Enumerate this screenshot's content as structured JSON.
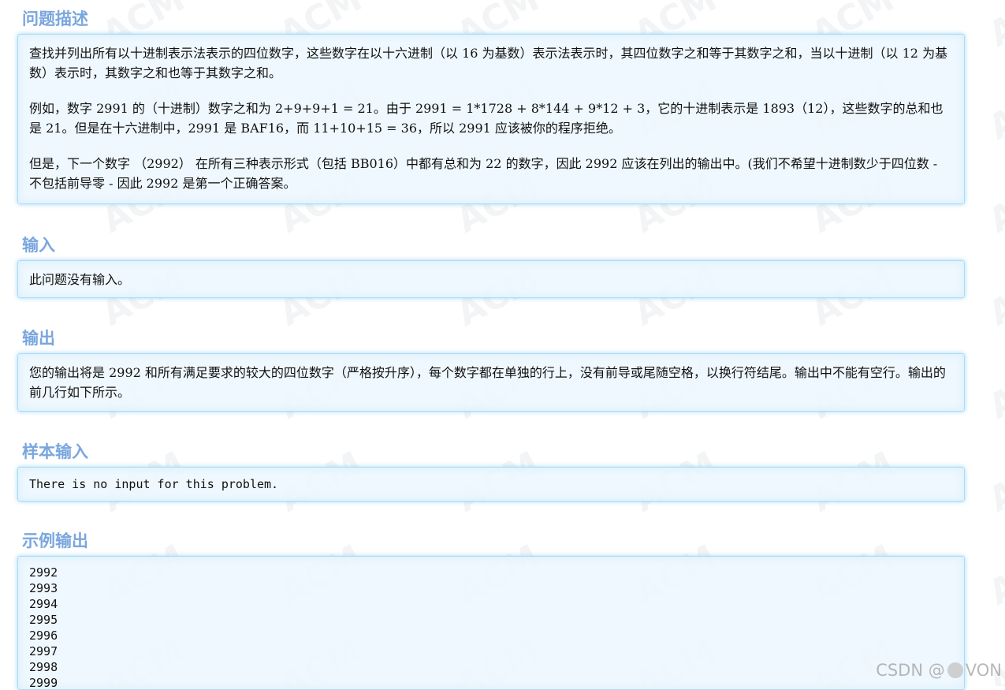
{
  "sections": {
    "description": {
      "title": "问题描述",
      "paragraphs": [
        "查找并列出所有以十进制表示法表示的四位数字，这些数字在以十六进制（以 16 为基数）表示法表示时，其四位数字之和等于其数字之和，当以十进制（以 12 为基数）表示时，其数字之和也等于其数字之和。",
        "例如，数字 2991 的（十进制）数字之和为 2+9+9+1 = 21。由于 2991 = 1*1728 + 8*144 + 9*12 + 3，它的十进制表示是 1893（12），这些数字的总和也是 21。但是在十六进制中，2991 是 BAF16，而 11+10+15 = 36，所以 2991 应该被你的程序拒绝。",
        "但是，下一个数字 （2992） 在所有三种表示形式（包括 BB016）中都有总和为 22 的数字，因此 2992 应该在列出的输出中。(我们不希望十进制数少于四位数 - 不包括前导零 - 因此 2992 是第一个正确答案。"
      ]
    },
    "input": {
      "title": "输入",
      "text": "此问题没有输入。"
    },
    "output": {
      "title": "输出",
      "text": "您的输出将是 2992 和所有满足要求的较大的四位数字（严格按升序），每个数字都在单独的行上，没有前导或尾随空格，以换行符结尾。输出中不能有空行。输出的前几行如下所示。"
    },
    "sample_input": {
      "title": "样本输入",
      "text": "There is no input for this problem."
    },
    "sample_output": {
      "title": "示例输出",
      "lines": [
        "2992",
        "2993",
        "2994",
        "2995",
        "2996",
        "2997",
        "2998",
        "2999"
      ]
    }
  },
  "watermark": {
    "text": "ACM"
  },
  "csdn": {
    "prefix": "CSDN @",
    "suffix": "VON"
  },
  "colors": {
    "title": "#7aa6de",
    "box_border": "#aedcf3",
    "box_bg": "#ecf7fe"
  }
}
